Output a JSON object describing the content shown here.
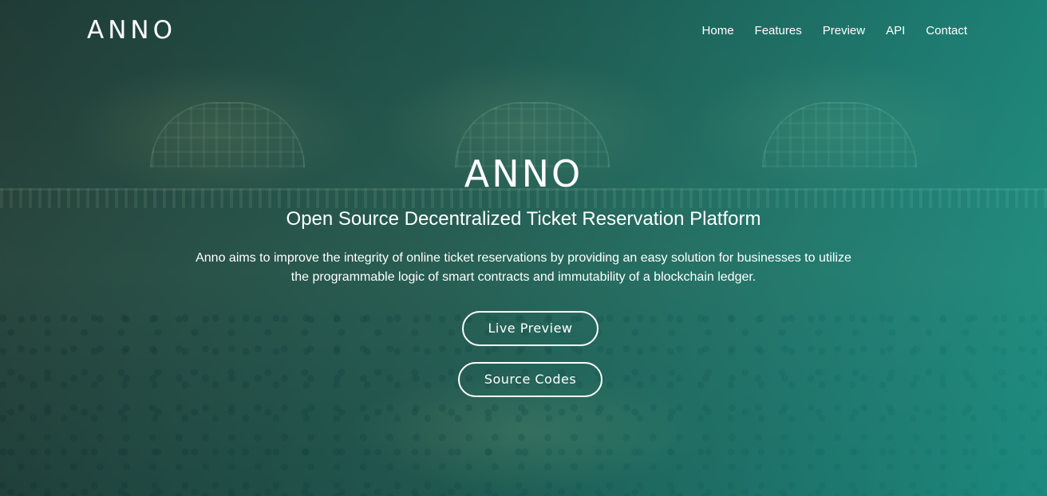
{
  "nav": {
    "logo": "ANNO",
    "items": [
      {
        "label": "Home"
      },
      {
        "label": "Features"
      },
      {
        "label": "Preview"
      },
      {
        "label": "API"
      },
      {
        "label": "Contact"
      }
    ]
  },
  "hero": {
    "title": "ANNO",
    "subtitle": "Open Source Decentralized Ticket Reservation Platform",
    "description": "Anno aims to improve the integrity of online ticket reservations by providing an easy solution for businesses to utilize the programmable logic of smart contracts and immutability of a blockchain ledger.",
    "buttons": {
      "live_preview": "Live Preview",
      "source_codes": "Source Codes"
    }
  },
  "colors": {
    "overlay_left": "#1e4a46",
    "overlay_right": "#14aaa0",
    "text": "#ffffff"
  }
}
